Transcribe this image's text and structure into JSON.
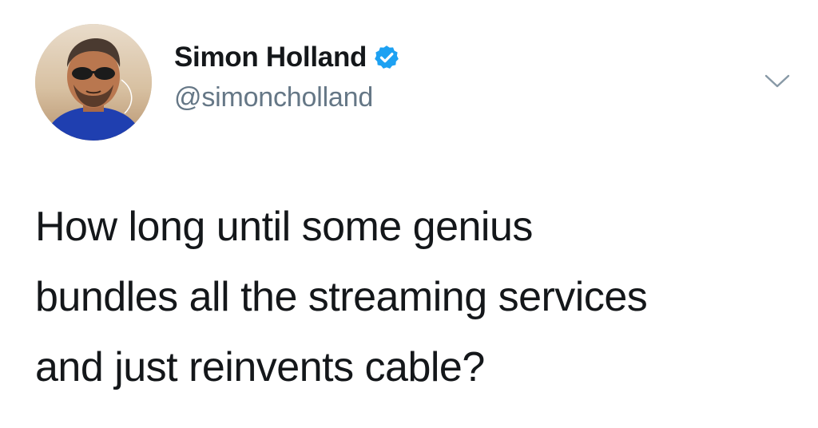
{
  "user": {
    "display_name": "Simon Holland",
    "handle": "@simoncholland",
    "verified": true
  },
  "tweet": {
    "lines": [
      "How long until some genius",
      "bundles all the streaming services",
      "and just reinvents cable?"
    ]
  },
  "icons": {
    "verified": "verified-badge-icon",
    "menu": "chevron-down-icon",
    "avatar": "profile-photo"
  },
  "colors": {
    "verified_blue": "#1da1f2",
    "handle_gray": "#657786",
    "text": "#14171a",
    "background": "#ffffff"
  }
}
